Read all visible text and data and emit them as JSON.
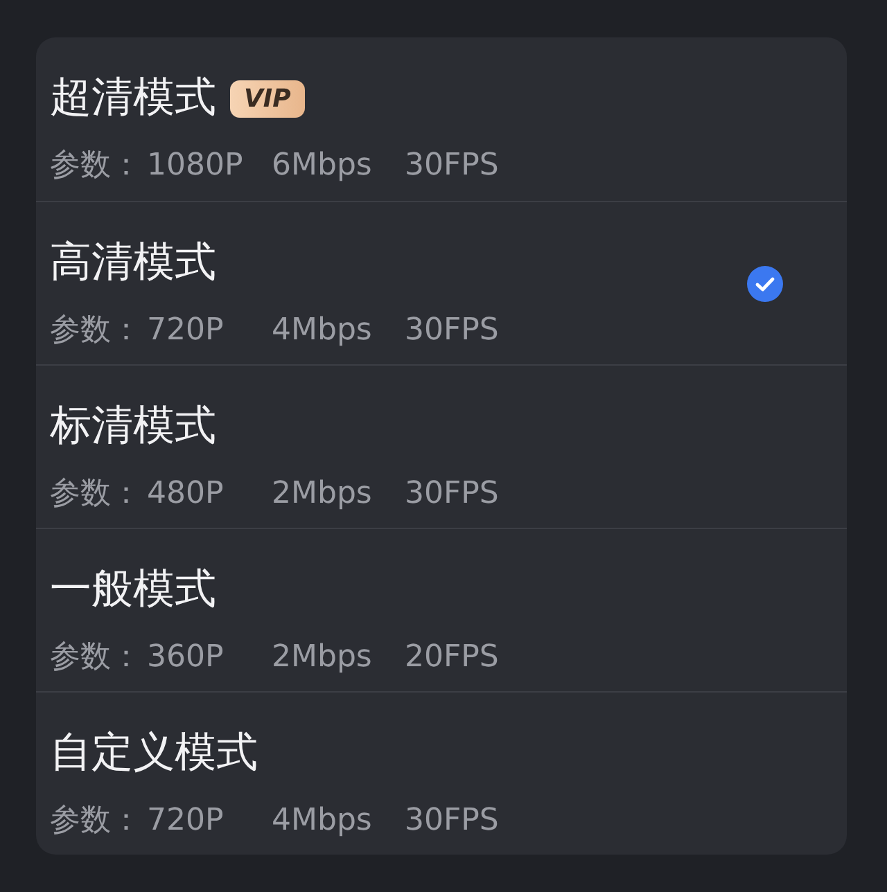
{
  "modes": [
    {
      "title": "超清模式",
      "badge": "VIP",
      "selected": false,
      "param_label": "参数：",
      "resolution": "1080P",
      "bitrate": "6Mbps",
      "fps": "30FPS"
    },
    {
      "title": "高清模式",
      "selected": true,
      "param_label": "参数：",
      "resolution": "720P",
      "bitrate": "4Mbps",
      "fps": "30FPS"
    },
    {
      "title": "标清模式",
      "selected": false,
      "param_label": "参数：",
      "resolution": "480P",
      "bitrate": "2Mbps",
      "fps": "30FPS"
    },
    {
      "title": "一般模式",
      "selected": false,
      "param_label": "参数：",
      "resolution": "360P",
      "bitrate": "2Mbps",
      "fps": "20FPS"
    },
    {
      "title": "自定义模式",
      "selected": false,
      "param_label": "参数：",
      "resolution": "720P",
      "bitrate": "4Mbps",
      "fps": "30FPS"
    }
  ]
}
